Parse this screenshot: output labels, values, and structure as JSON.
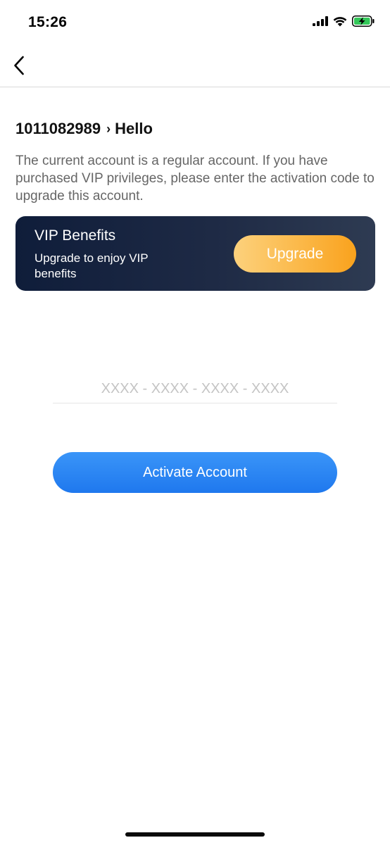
{
  "status_bar": {
    "time": "15:26",
    "icons": [
      "cellular-signal-icon",
      "wifi-icon",
      "battery-charging-icon"
    ]
  },
  "nav": {
    "back_icon": "chevron-left-icon"
  },
  "account": {
    "id": "1011082989",
    "separator": "›",
    "greeting": "Hello",
    "description": "The current account is a regular account. If you have purchased VIP privileges, please enter the activation code to upgrade this account."
  },
  "vip_card": {
    "title": "VIP Benefits",
    "subtitle": "Upgrade to enjoy VIP benefits",
    "upgrade_label": "Upgrade"
  },
  "activation": {
    "code_value": "",
    "code_placeholder": "XXXX - XXXX - XXXX - XXXX",
    "button_label": "Activate Account"
  },
  "colors": {
    "primary_blue": "#2b86f3",
    "vip_gold": "#fbb848",
    "vip_card_dark": "#0f1d3a",
    "battery_green": "#34c759"
  }
}
